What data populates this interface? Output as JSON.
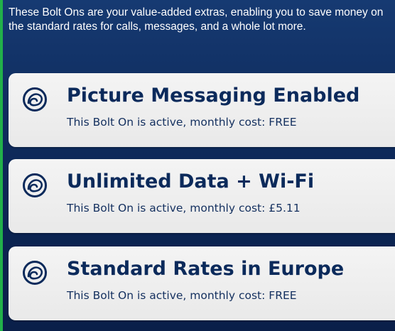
{
  "intro_text": "These Bolt Ons are your value-added extras, enabling you to save money on the standard rates for calls, messages, and a whole lot more.",
  "colors": {
    "background_top": "#163a72",
    "background_bottom": "#0a1f49",
    "card": "#eeeeee",
    "title": "#0b2a5b",
    "accent_left": "#22b04a"
  },
  "bolt_ons": [
    {
      "icon": "bolt-on-icon",
      "title": "Picture Messaging Enabled",
      "status": "This Bolt On is active, monthly cost: FREE"
    },
    {
      "icon": "bolt-on-icon",
      "title": "Unlimited Data + Wi-Fi",
      "status": "This Bolt On is active, monthly cost: £5.11"
    },
    {
      "icon": "bolt-on-icon",
      "title": "Standard Rates in Europe",
      "status": "This Bolt On is active, monthly cost: FREE"
    }
  ]
}
